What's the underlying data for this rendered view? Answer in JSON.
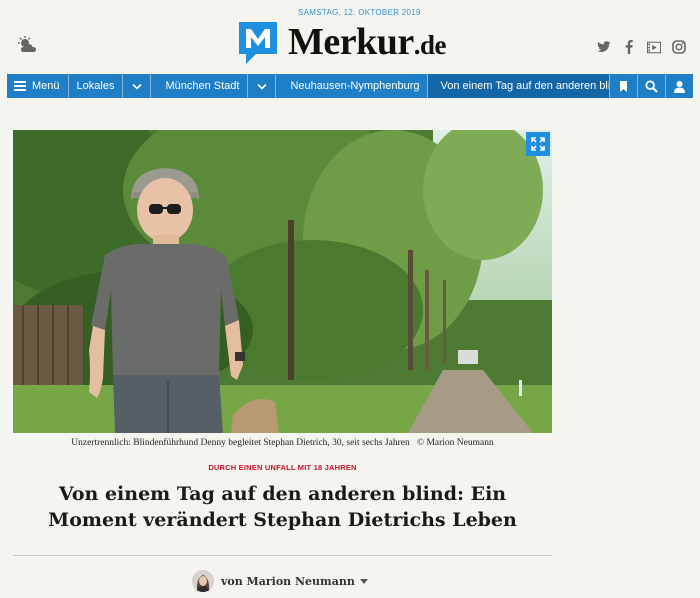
{
  "header": {
    "date": "SAMSTAG, 12. OKTOBER 2019",
    "logo_main": "Merkur",
    "logo_tld": ".de",
    "weather_icon": "partly-cloudy-icon",
    "social_icons": [
      "twitter-icon",
      "facebook-icon",
      "video-icon",
      "instagram-icon"
    ]
  },
  "nav": {
    "menu_label": "Menü",
    "items": [
      "Lokales",
      "München Stadt",
      "Neuhausen-Nymphenburg"
    ],
    "active": "Von einem Tag auf den anderen blind",
    "accent": "#1f7fc6"
  },
  "article": {
    "caption": "Unzertrennlich: Blindenführhund Denny begleitet Stephan Dietrich, 30, seit sechs Jahren",
    "credit": "© Marion Neumann",
    "kicker": "DURCH EINEN UNFALL MIT 18 JAHREN",
    "headline": "Von einem Tag auf den anderen blind: Ein Moment verändert Stephan Dietrichs Leben",
    "author": "von Marion Neumann",
    "kicker_color": "#c8102e"
  }
}
